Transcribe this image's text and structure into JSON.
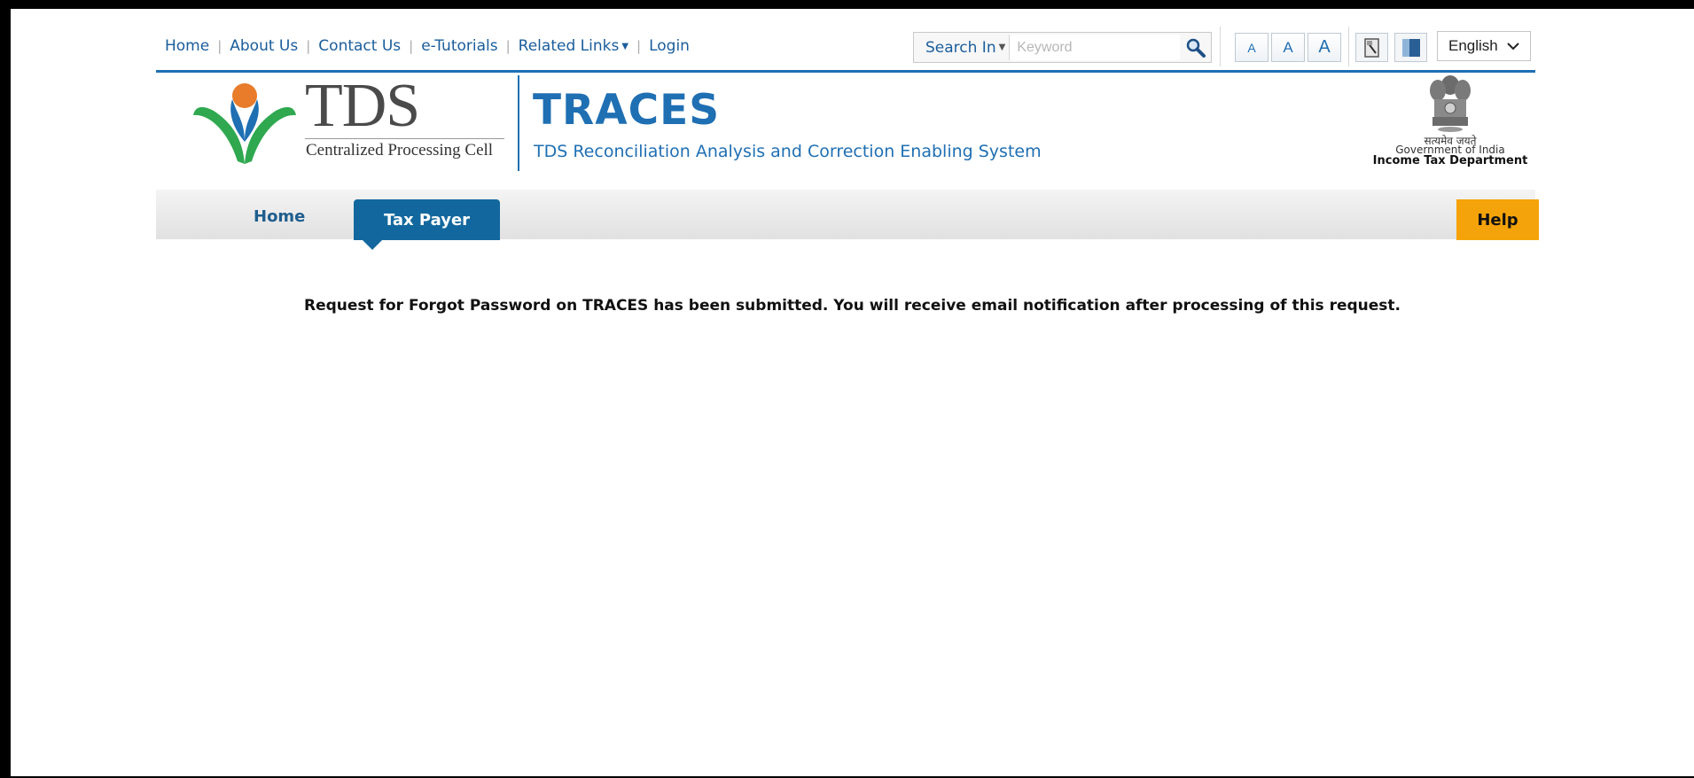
{
  "toplinks": {
    "home": "Home",
    "about": "About Us",
    "contact": "Contact Us",
    "tutorials": "e-Tutorials",
    "related": "Related Links",
    "login": "Login"
  },
  "search": {
    "scope_label": "Search In",
    "placeholder": "Keyword",
    "icon": "magnifier-icon"
  },
  "font_size_buttons": [
    "A",
    "A",
    "A"
  ],
  "icons": [
    "print-icon",
    "contrast-icon"
  ],
  "language": {
    "selected": "English"
  },
  "logo": {
    "title": "TDS",
    "subtitle": "Centralized Processing Cell"
  },
  "traces": {
    "title": "TRACES",
    "subtitle": "TDS Reconciliation Analysis and Correction Enabling System"
  },
  "emblem": {
    "motto": "सत्यमेव जयते",
    "govt": "Government of India",
    "dept": "Income Tax Department"
  },
  "nav": {
    "home": "Home",
    "taxpayer": "Tax Payer",
    "help": "Help"
  },
  "message": "Request for Forgot Password on TRACES has been submitted. You will receive email notification after processing of this request.",
  "colors": {
    "primary": "#1f6fb3",
    "tab": "#12689e",
    "help": "#f5a30a"
  }
}
